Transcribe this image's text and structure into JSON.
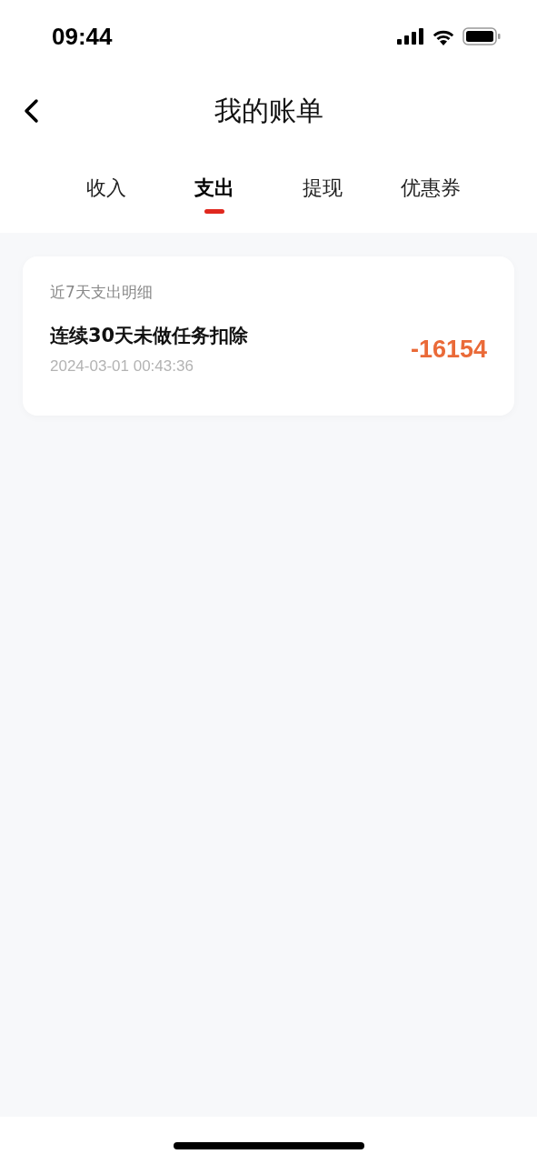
{
  "status_bar": {
    "time": "09:44"
  },
  "header": {
    "title": "我的账单"
  },
  "tabs": [
    {
      "label": "收入",
      "selected": false
    },
    {
      "label": "支出",
      "selected": true
    },
    {
      "label": "提现",
      "selected": false
    },
    {
      "label": "优惠券",
      "selected": false
    }
  ],
  "section": {
    "title": "近7天支出明细",
    "records": [
      {
        "title": "连续30天未做任务扣除",
        "time": "2024-03-01 00:43:36",
        "amount": "-16154"
      }
    ]
  }
}
